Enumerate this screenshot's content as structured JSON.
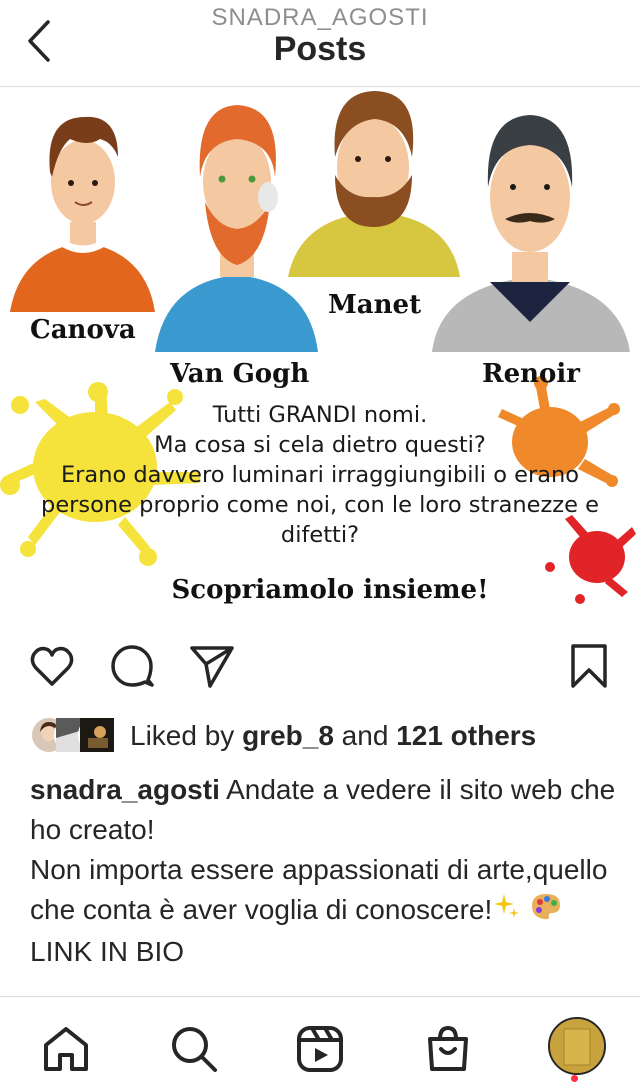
{
  "header": {
    "username": "SNADRA_AGOSTI",
    "title": "Posts"
  },
  "post": {
    "names": {
      "canova": "Canova",
      "vangogh": "Van Gogh",
      "manet": "Manet",
      "renoir": "Renoir"
    },
    "text_lines": [
      "Tutti GRANDI nomi.",
      "Ma cosa si cela dietro questi?",
      "Erano davvero luminari irraggiungibili o erano",
      "persone proprio come noi, con le loro stranezze e",
      "difetti?"
    ],
    "cta": "Scopriamolo insieme!",
    "colors": {
      "yellow_splash": "#f5e23a",
      "orange_splash": "#f0892a",
      "red_splash": "#e02427"
    }
  },
  "likes": {
    "prefix": "Liked by ",
    "user": "greb_8",
    "middle": " and ",
    "others": "121 others"
  },
  "caption": {
    "username": "snadra_agosti",
    "text_1": " Andate a vedere il sito web che ho creato!",
    "text_2": "Non importa essere appassionati di arte,quello che conta è aver voglia di conoscere!",
    "emoji_1": "✨",
    "emoji_2": "🎨",
    "text_3": "LINK IN BIO"
  },
  "icons": {
    "back": "chevron-left-icon",
    "like": "heart-icon",
    "comment": "comment-icon",
    "share": "paper-plane-icon",
    "save": "bookmark-icon",
    "home": "home-icon",
    "search": "search-icon",
    "reels": "reels-icon",
    "shop": "shop-bag-icon"
  }
}
